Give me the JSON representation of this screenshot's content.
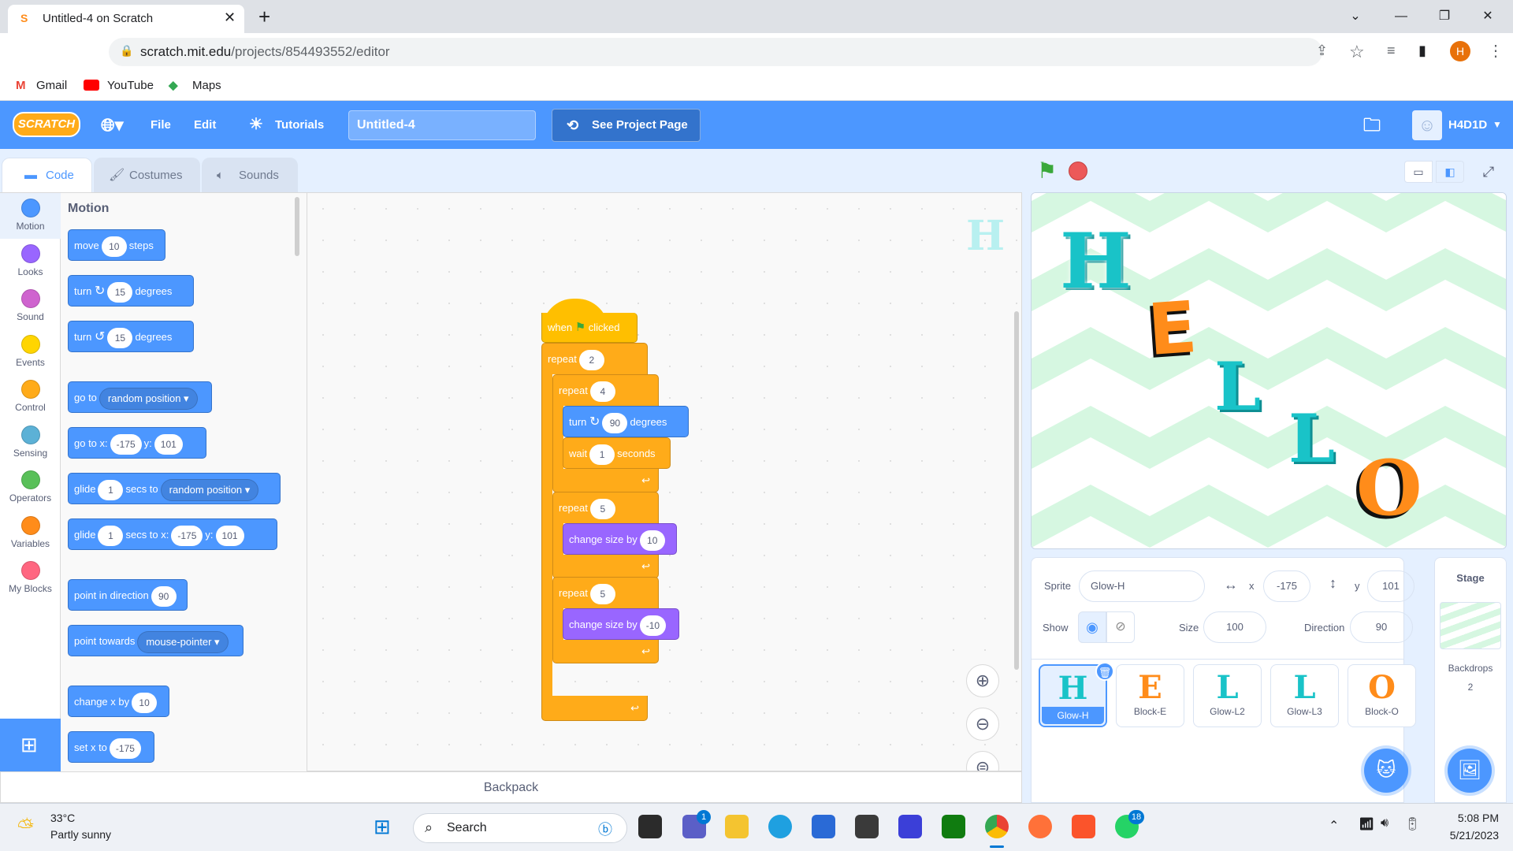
{
  "browser": {
    "tab_title": "Untitled-4 on Scratch",
    "url_host": "scratch.mit.edu",
    "url_path": "/projects/854493552/editor",
    "bookmarks": [
      "Gmail",
      "YouTube",
      "Maps"
    ],
    "profile_initial": "H"
  },
  "menubar": {
    "logo": "SCRATCH",
    "file": "File",
    "edit": "Edit",
    "tutorials": "Tutorials",
    "project_title": "Untitled-4",
    "see_project_page": "See Project Page",
    "username": "H4D1D"
  },
  "editor_tabs": [
    "Code",
    "Costumes",
    "Sounds"
  ],
  "categories": [
    {
      "label": "Motion",
      "color": "#4c97ff"
    },
    {
      "label": "Looks",
      "color": "#9966ff"
    },
    {
      "label": "Sound",
      "color": "#cf63cf"
    },
    {
      "label": "Events",
      "color": "#ffd500"
    },
    {
      "label": "Control",
      "color": "#ffab19"
    },
    {
      "label": "Sensing",
      "color": "#5cb1d6"
    },
    {
      "label": "Operators",
      "color": "#59c059"
    },
    {
      "label": "Variables",
      "color": "#ff8c1a"
    },
    {
      "label": "My Blocks",
      "color": "#ff6680"
    }
  ],
  "palette": {
    "heading": "Motion",
    "move": {
      "a": "move",
      "v": "10",
      "b": "steps"
    },
    "turn_right": {
      "a": "turn",
      "v": "15",
      "b": "degrees"
    },
    "turn_left": {
      "a": "turn",
      "v": "15",
      "b": "degrees"
    },
    "goto": {
      "a": "go to",
      "dd": "random position"
    },
    "goto_xy": {
      "a": "go to x:",
      "x": "-175",
      "yl": "y:",
      "y": "101"
    },
    "glide": {
      "a": "glide",
      "v": "1",
      "b": "secs to",
      "dd": "random position"
    },
    "glide_xy": {
      "a": "glide",
      "v": "1",
      "b": "secs to x:",
      "x": "-175",
      "yl": "y:",
      "y": "101"
    },
    "point_dir": {
      "a": "point in direction",
      "v": "90"
    },
    "point_towards": {
      "a": "point towards",
      "dd": "mouse-pointer"
    },
    "change_x": {
      "a": "change x by",
      "v": "10"
    },
    "set_x": {
      "a": "set x to",
      "v": "-175"
    }
  },
  "script": {
    "hat": {
      "a": "when",
      "b": "clicked"
    },
    "repeat1": {
      "a": "repeat",
      "v": "2"
    },
    "repeat2": {
      "a": "repeat",
      "v": "4"
    },
    "turn": {
      "a": "turn",
      "v": "90",
      "b": "degrees"
    },
    "wait": {
      "a": "wait",
      "v": "1",
      "b": "seconds"
    },
    "repeat3": {
      "a": "repeat",
      "v": "5"
    },
    "change_size1": {
      "a": "change size by",
      "v": "10"
    },
    "repeat4": {
      "a": "repeat",
      "v": "5"
    },
    "change_size2": {
      "a": "change size by",
      "v": "-10"
    }
  },
  "canvas_sprite_preview": "H",
  "backpack": "Backpack",
  "stage_letters": [
    "H",
    "E",
    "L",
    "L",
    "O"
  ],
  "sprite_info": {
    "sprite_label": "Sprite",
    "sprite_name": "Glow-H",
    "x_label": "x",
    "x": "-175",
    "y_label": "y",
    "y": "101",
    "show_label": "Show",
    "size_label": "Size",
    "size": "100",
    "direction_label": "Direction",
    "direction": "90"
  },
  "sprites": [
    {
      "name": "Glow-H",
      "glyph": "H",
      "color": "#19c3c8",
      "selected": true
    },
    {
      "name": "Block-E",
      "glyph": "E",
      "color": "#ff8c1a",
      "selected": false
    },
    {
      "name": "Glow-L2",
      "glyph": "L",
      "color": "#19c3c8",
      "selected": false
    },
    {
      "name": "Glow-L3",
      "glyph": "L",
      "color": "#19c3c8",
      "selected": false
    },
    {
      "name": "Block-O",
      "glyph": "O",
      "color": "#ff8c1a",
      "selected": false
    }
  ],
  "stage_pane": {
    "title": "Stage",
    "backdrops_label": "Backdrops",
    "backdrops_count": "2"
  },
  "taskbar": {
    "temp": "33°C",
    "weather": "Partly sunny",
    "search": "Search",
    "time": "5:08 PM",
    "date": "5/21/2023",
    "badge_teams": "1",
    "badge_whatsapp": "18"
  },
  "colors": {
    "scratch_blue": "#4c97ff",
    "motion": "#4c97ff",
    "looks": "#9966ff",
    "control": "#ffab19",
    "events": "#ffbf00",
    "glow": "#19c3c8",
    "block_orange": "#ff8c1a"
  }
}
